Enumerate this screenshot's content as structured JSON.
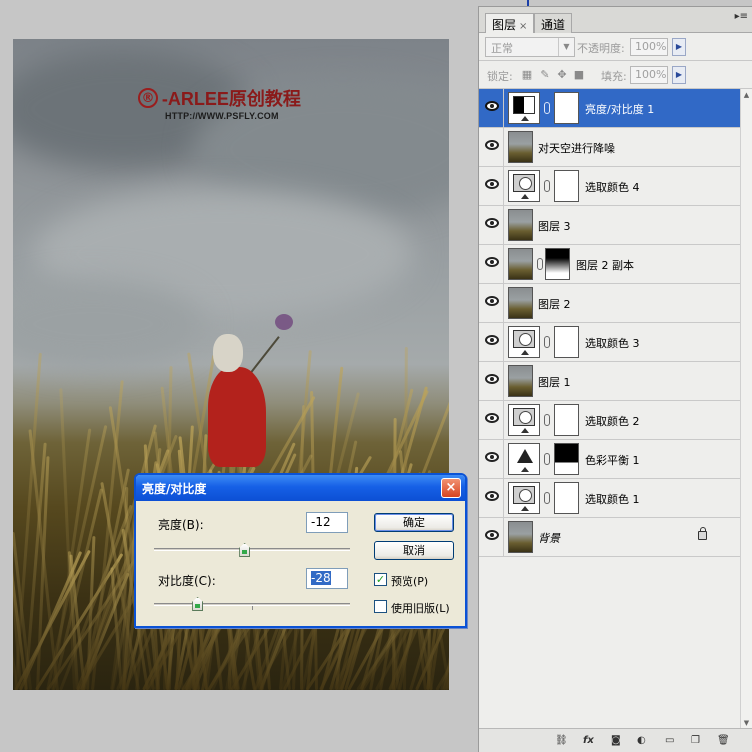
{
  "watermark": {
    "symbol": "®",
    "brand": "-ARLEE原创教程",
    "url": "HTTP://WWW.PSFLY.COM"
  },
  "panel": {
    "tabs": [
      {
        "label": "图层",
        "close": "×"
      },
      {
        "label": "通道"
      }
    ],
    "menu_icon": "panel-menu-icon",
    "blend_mode": "正常",
    "opacity_label": "不透明度:",
    "opacity_value": "100%",
    "lock_label": "锁定:",
    "fill_label": "填充:",
    "fill_value": "100%",
    "layers": [
      {
        "name": "亮度/对比度 1",
        "type": "adjustment-brightness-contrast",
        "selected": true,
        "mask": "white"
      },
      {
        "name": "对天空进行降噪",
        "type": "pixel",
        "selected": false
      },
      {
        "name": "选取颜色 4",
        "type": "adjustment-selective-color",
        "selected": false,
        "mask": "white"
      },
      {
        "name": "图层 3",
        "type": "pixel",
        "selected": false
      },
      {
        "name": "图层 2 副本",
        "type": "pixel",
        "selected": false,
        "mask": "gradient"
      },
      {
        "name": "图层 2",
        "type": "pixel",
        "selected": false
      },
      {
        "name": "选取颜色 3",
        "type": "adjustment-selective-color",
        "selected": false,
        "mask": "white"
      },
      {
        "name": "图层 1",
        "type": "pixel",
        "selected": false
      },
      {
        "name": "选取颜色 2",
        "type": "adjustment-selective-color",
        "selected": false,
        "mask": "white"
      },
      {
        "name": "色彩平衡 1",
        "type": "adjustment-color-balance",
        "selected": false,
        "mask": "black-top"
      },
      {
        "name": "选取颜色 1",
        "type": "adjustment-selective-color",
        "selected": false,
        "mask": "white"
      },
      {
        "name": "背景",
        "type": "background",
        "selected": false,
        "locked": true
      }
    ],
    "footer_icons": [
      "link-layers-icon",
      "fx-icon",
      "add-mask-icon",
      "adjustment-layer-icon",
      "new-group-icon",
      "new-layer-icon",
      "trash-icon"
    ],
    "footer_fx": "fx"
  },
  "dialog": {
    "title": "亮度/对比度",
    "close": "×",
    "brightness_label": "亮度(B):",
    "brightness_value": "-12",
    "contrast_label": "对比度(C):",
    "contrast_value": "-28",
    "ok_label": "确定",
    "cancel_label": "取消",
    "preview_label": "预览(P)",
    "preview_checked": true,
    "legacy_label": "使用旧版(L)",
    "legacy_checked": false,
    "brightness_slider_fraction": 0.46,
    "contrast_slider_fraction": 0.22
  },
  "colors": {
    "selection": "#3169c6",
    "title_bar": "#0c4fd4",
    "panel": "#eeeeec"
  }
}
